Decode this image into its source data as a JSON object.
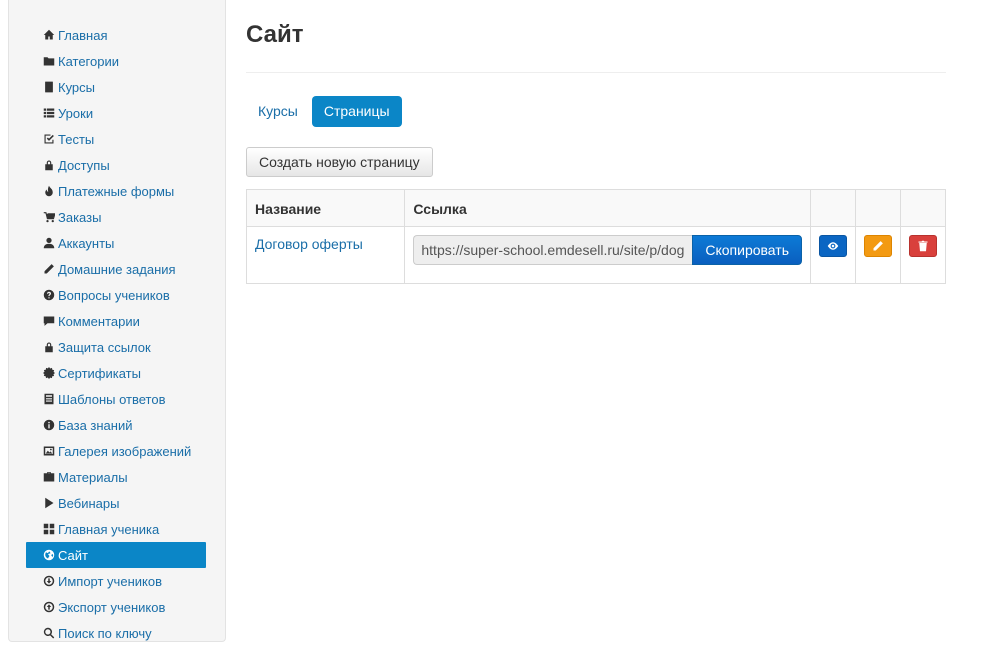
{
  "sidebar": {
    "items": [
      {
        "label": "Главная",
        "icon": "home-icon"
      },
      {
        "label": "Категории",
        "icon": "folder-icon"
      },
      {
        "label": "Курсы",
        "icon": "book-icon"
      },
      {
        "label": "Уроки",
        "icon": "list-icon"
      },
      {
        "label": "Тесты",
        "icon": "check-edit-icon"
      },
      {
        "label": "Доступы",
        "icon": "lock-icon"
      },
      {
        "label": "Платежные формы",
        "icon": "fire-icon"
      },
      {
        "label": "Заказы",
        "icon": "cart-icon"
      },
      {
        "label": "Аккаунты",
        "icon": "user-icon"
      },
      {
        "label": "Домашние задания",
        "icon": "pencil-icon"
      },
      {
        "label": "Вопросы учеников",
        "icon": "question-icon"
      },
      {
        "label": "Комментарии",
        "icon": "comment-icon"
      },
      {
        "label": "Защита ссылок",
        "icon": "lock-icon"
      },
      {
        "label": "Сертификаты",
        "icon": "certificate-icon"
      },
      {
        "label": "Шаблоны ответов",
        "icon": "template-icon"
      },
      {
        "label": "База знаний",
        "icon": "info-icon"
      },
      {
        "label": "Галерея изображений",
        "icon": "picture-icon"
      },
      {
        "label": "Материалы",
        "icon": "briefcase-icon"
      },
      {
        "label": "Вебинары",
        "icon": "play-icon"
      },
      {
        "label": "Главная ученика",
        "icon": "grid-icon"
      },
      {
        "label": "Сайт",
        "icon": "globe-icon",
        "active": true
      },
      {
        "label": "Импорт учеников",
        "icon": "import-icon"
      },
      {
        "label": "Экспорт учеников",
        "icon": "export-icon"
      },
      {
        "label": "Поиск по ключу",
        "icon": "search-icon"
      }
    ]
  },
  "main": {
    "title": "Сайт",
    "tabs": [
      {
        "label": "Курсы",
        "active": false
      },
      {
        "label": "Страницы",
        "active": true
      }
    ],
    "create_button": "Создать новую страницу",
    "table": {
      "headers": [
        "Название",
        "Ссылка",
        "",
        "",
        ""
      ],
      "rows": [
        {
          "name": "Договор оферты",
          "link": "https://super-school.emdesell.ru/site/p/dogovor-oferty",
          "copy_label": "Скопировать"
        }
      ]
    }
  },
  "colors": {
    "accent": "#0b86c7",
    "link": "#1a6ea8",
    "view": "#0b66c3",
    "edit": "#f39a12",
    "delete": "#d9403c"
  }
}
